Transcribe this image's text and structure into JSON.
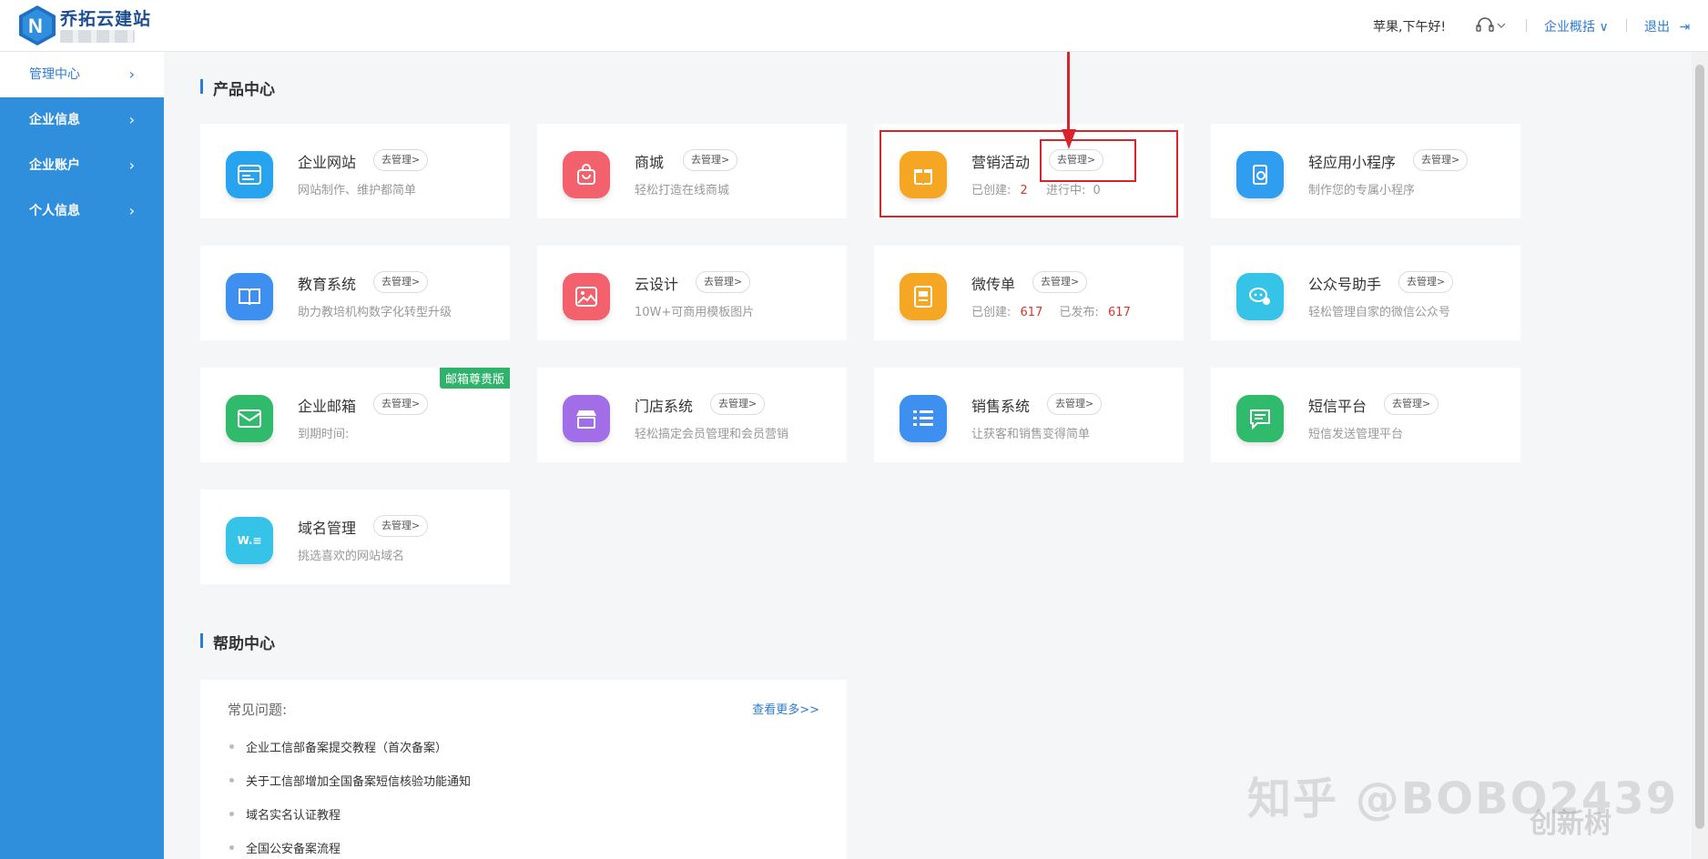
{
  "header": {
    "brand": "乔拓云建站",
    "greeting": "苹果,下午好!",
    "overview_label": "企业概括 ∨",
    "logout_label": "退出"
  },
  "sidebar": {
    "items": [
      {
        "label": "管理中心"
      },
      {
        "label": "企业信息"
      },
      {
        "label": "企业账户"
      },
      {
        "label": "个人信息"
      }
    ]
  },
  "products": {
    "title": "产品中心",
    "manage_label": "去管理>",
    "cards": [
      {
        "name": "企业网站",
        "desc": "网站制作、维护都简单",
        "icon": "website-icon",
        "color": "#27a4ef"
      },
      {
        "name": "商城",
        "desc": "轻松打造在线商城",
        "icon": "shopping-bag-icon",
        "color": "#f2616c"
      },
      {
        "name": "营销活动",
        "desc_a": "已创建:",
        "num_a": "2",
        "desc_b": "进行中:",
        "num_b": "0",
        "icon": "gift-icon",
        "color": "#f5a623"
      },
      {
        "name": "轻应用小程序",
        "desc": "制作您的专属小程序",
        "icon": "mini-program-icon",
        "color": "#2f9df0"
      },
      {
        "name": "教育系统",
        "desc": "助力教培机构数字化转型升级",
        "icon": "book-icon",
        "color": "#3d8ff0"
      },
      {
        "name": "云设计",
        "desc": "10W+可商用模板图片",
        "icon": "image-icon",
        "color": "#f2616c"
      },
      {
        "name": "微传单",
        "desc_a": "已创建:",
        "num_a": "617",
        "desc_b": "已发布:",
        "num_b": "617",
        "icon": "flyer-icon",
        "color": "#f5a623"
      },
      {
        "name": "公众号助手",
        "desc": "轻松管理自家的微信公众号",
        "icon": "wechat-icon",
        "color": "#36c3e8"
      },
      {
        "name": "企业邮箱",
        "desc": "到期时间:",
        "badge": "邮箱尊贵版",
        "icon": "mail-icon",
        "color": "#2fbb6b"
      },
      {
        "name": "门店系统",
        "desc": "轻松搞定会员管理和会员营销",
        "icon": "store-icon",
        "color": "#a26ee8"
      },
      {
        "name": "销售系统",
        "desc": "让获客和销售变得简单",
        "icon": "list-icon",
        "color": "#3d8ff0"
      },
      {
        "name": "短信平台",
        "desc": "短信发送管理平台",
        "icon": "message-icon",
        "color": "#2fbb6b"
      },
      {
        "name": "域名管理",
        "desc": "挑选喜欢的网站域名",
        "icon": "domain-icon",
        "color": "#36c3e8",
        "icon_text": "W.≡"
      }
    ]
  },
  "help": {
    "title": "帮助中心",
    "faq_label": "常见问题:",
    "more_label": "查看更多>>",
    "items": [
      "企业工信部备案提交教程（首次备案）",
      "关于工信部增加全国备案短信核验功能通知",
      "域名实名认证教程",
      "全国公安备案流程"
    ]
  },
  "watermark": {
    "text": "知乎 @BOBO2439",
    "brand": "创新树"
  }
}
